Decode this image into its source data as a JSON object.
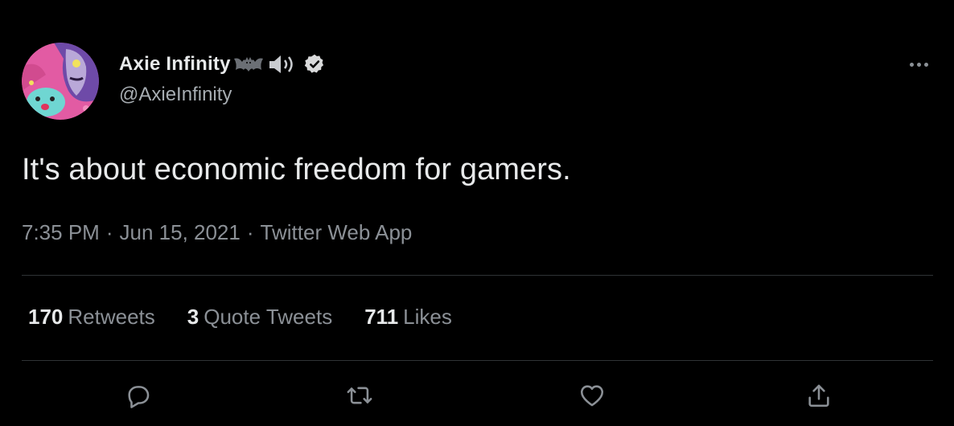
{
  "author": {
    "display_name": "Axie Infinity",
    "handle": "@AxieInfinity",
    "verified": true,
    "emojis": [
      "bat-emoji",
      "speaker-emoji"
    ],
    "avatar_icon": "axie-avatar"
  },
  "tweet": {
    "text": "It's about economic freedom for gamers.",
    "time": "7:35 PM",
    "date": "Jun 15, 2021",
    "source": "Twitter Web App",
    "separator": "·"
  },
  "stats": {
    "retweets_count": "170",
    "retweets_label": "Retweets",
    "quotes_count": "3",
    "quotes_label": "Quote Tweets",
    "likes_count": "711",
    "likes_label": "Likes"
  },
  "actions": [
    "reply-icon",
    "retweet-icon",
    "like-icon",
    "share-icon"
  ],
  "colors": {
    "background": "#000000",
    "text": "#e7e9ea",
    "secondary": "#8b9096",
    "divider": "#2f3336"
  }
}
